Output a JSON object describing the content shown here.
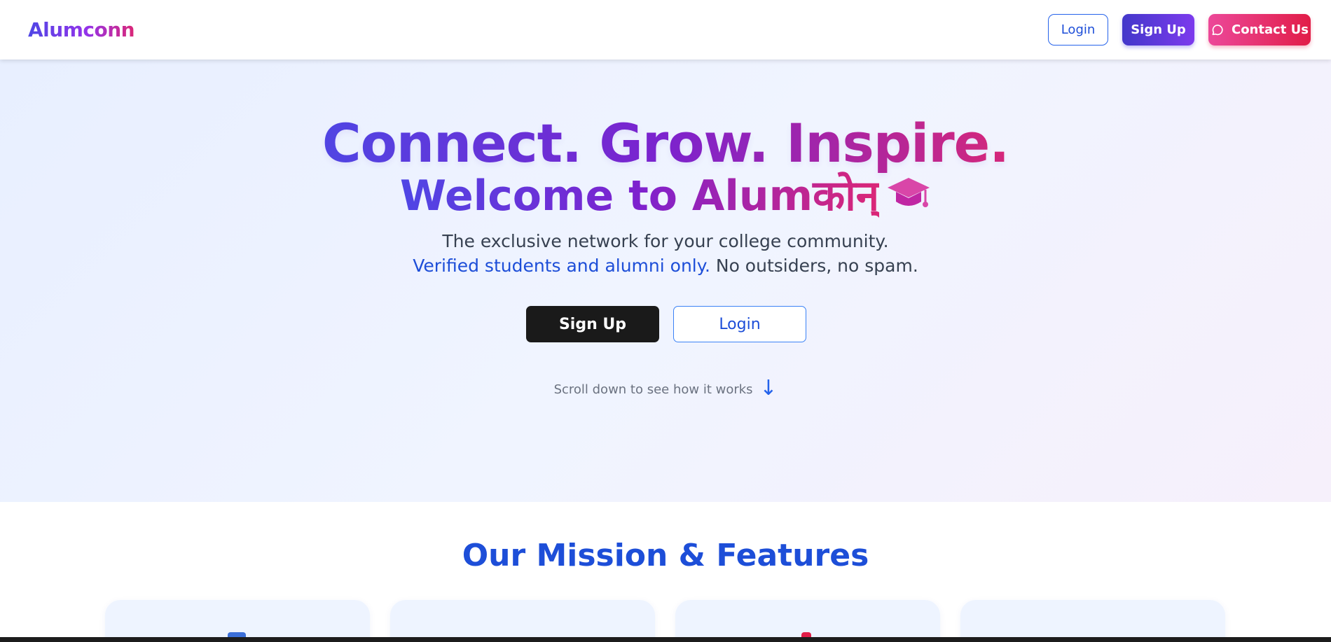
{
  "header": {
    "logo": "Alumconn",
    "login_label": "Login",
    "signup_label": "Sign Up",
    "contact_label": "Contact Us"
  },
  "hero": {
    "title": "Connect. Grow. Inspire.",
    "subtitle": "Welcome to Alumकोन्",
    "tagline_line1": "The exclusive network for your college community.",
    "tagline_highlight": "Verified students and alumni only.",
    "tagline_rest": " No outsiders, no spam.",
    "signup_label": "Sign Up",
    "login_label": "Login",
    "scroll_hint": "Scroll down to see how it works",
    "scroll_arrow": "↓"
  },
  "mission": {
    "title": "Our Mission & Features"
  },
  "icons": {
    "contact": "chat-bubble-icon",
    "graduation": "graduation-cap-icon"
  },
  "colors": {
    "brand_indigo": "#4f46e5",
    "brand_purple": "#7e22ce",
    "brand_pink": "#db2777",
    "link_blue": "#1d4ed8",
    "contact_red": "#e11d48"
  }
}
